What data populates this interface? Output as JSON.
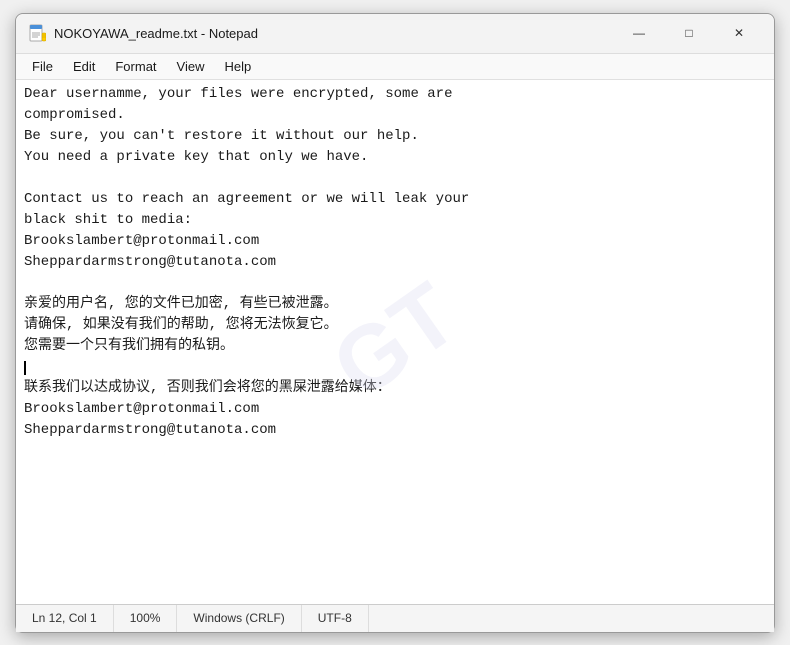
{
  "window": {
    "title": "NOKOYAWA_readme.txt - Notepad",
    "icon": "notepad"
  },
  "controls": {
    "minimize": "—",
    "maximize": "□",
    "close": "✕"
  },
  "menu": {
    "items": [
      "File",
      "Edit",
      "Format",
      "View",
      "Help"
    ]
  },
  "content": {
    "text": "Dear usernamme, your files were encrypted, some are\ncompromised.\nBe sure, you can't restore it without our help.\nYou need a private key that only we have.\n\nContact us to reach an agreement or we will leak your\nblack shit to media:\nBrookslambert@protonmail.com\nSheppardarmstrong@tutanota.com\n\n亲爱的用户名, 您的文件已加密, 有些已被泄露。\n请确保, 如果没有我们的帮助, 您将无法恢复它。\n您需要一个只有我们拥有的私钥。\n",
    "text2": "\n联系我们以达成协议, 否则我们会将您的黑屎泄露给媒体：\nBrookslambert@protonmail.com\nSheppardarmstrong@tutanota.com"
  },
  "status": {
    "position": "Ln 12, Col 1",
    "zoom": "100%",
    "line_ending": "Windows (CRLF)",
    "encoding": "UTF-8"
  },
  "watermark": {
    "text": "GT"
  }
}
